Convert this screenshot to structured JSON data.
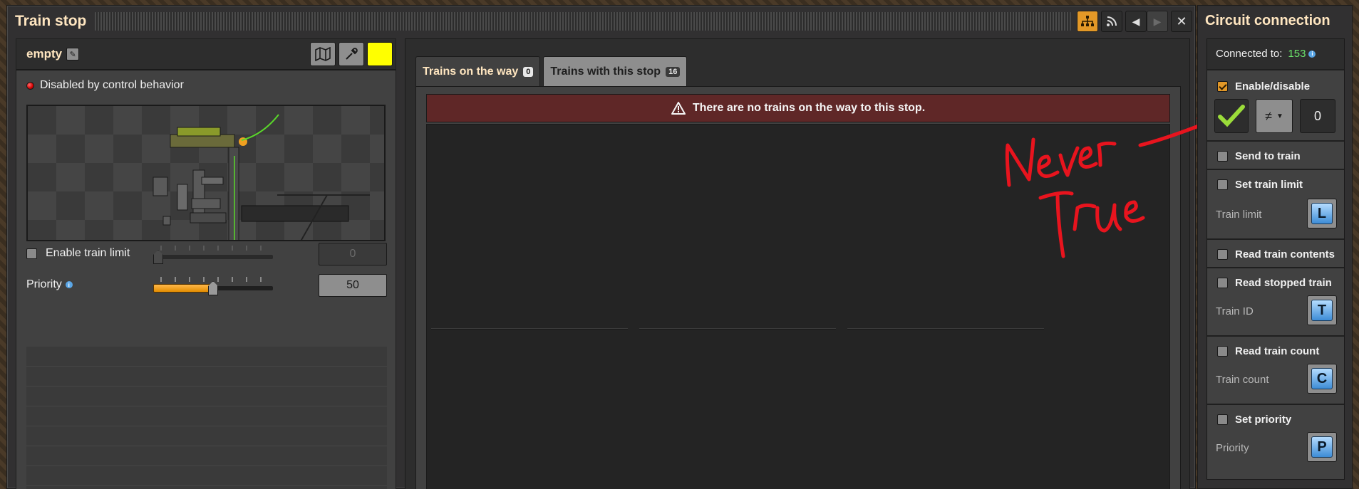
{
  "main_window": {
    "title": "Train stop"
  },
  "station": {
    "name": "empty",
    "status": "Disabled by control behavior",
    "color": "#ffff00"
  },
  "train_limit": {
    "label": "Enable train limit",
    "value": "0",
    "enabled": false
  },
  "priority": {
    "label": "Priority",
    "value": "50",
    "level_fraction": 0.5
  },
  "tabs": [
    {
      "label": "Trains on the way",
      "count": "0",
      "active": true
    },
    {
      "label": "Trains with this stop",
      "count": "16",
      "active": false
    }
  ],
  "warning": {
    "text": "There are no trains on the way to this stop."
  },
  "circuit": {
    "title": "Circuit connection",
    "connected_label": "Connected to:",
    "connected_value": "153",
    "enable_disable": {
      "label": "Enable/disable",
      "checked": true,
      "operator": "≠",
      "constant": "0"
    },
    "send_to_train": {
      "label": "Send to train"
    },
    "set_train_limit": {
      "label": "Set train limit",
      "sub_label": "Train limit",
      "signal": "L"
    },
    "read_train_contents": {
      "label": "Read train contents"
    },
    "read_stopped_train": {
      "label": "Read stopped train",
      "sub_label": "Train ID",
      "signal": "T"
    },
    "read_train_count": {
      "label": "Read train count",
      "sub_label": "Train count",
      "signal": "C"
    },
    "set_priority": {
      "label": "Set priority",
      "sub_label": "Priority",
      "signal": "P"
    }
  },
  "colors": {
    "accent_orange": "#e39827",
    "warning_red": "#5f2727",
    "connected_green": "#6ce46c",
    "annotation_red": "#e8141e"
  },
  "annotation": {
    "line1": "Never",
    "line2": "True"
  }
}
